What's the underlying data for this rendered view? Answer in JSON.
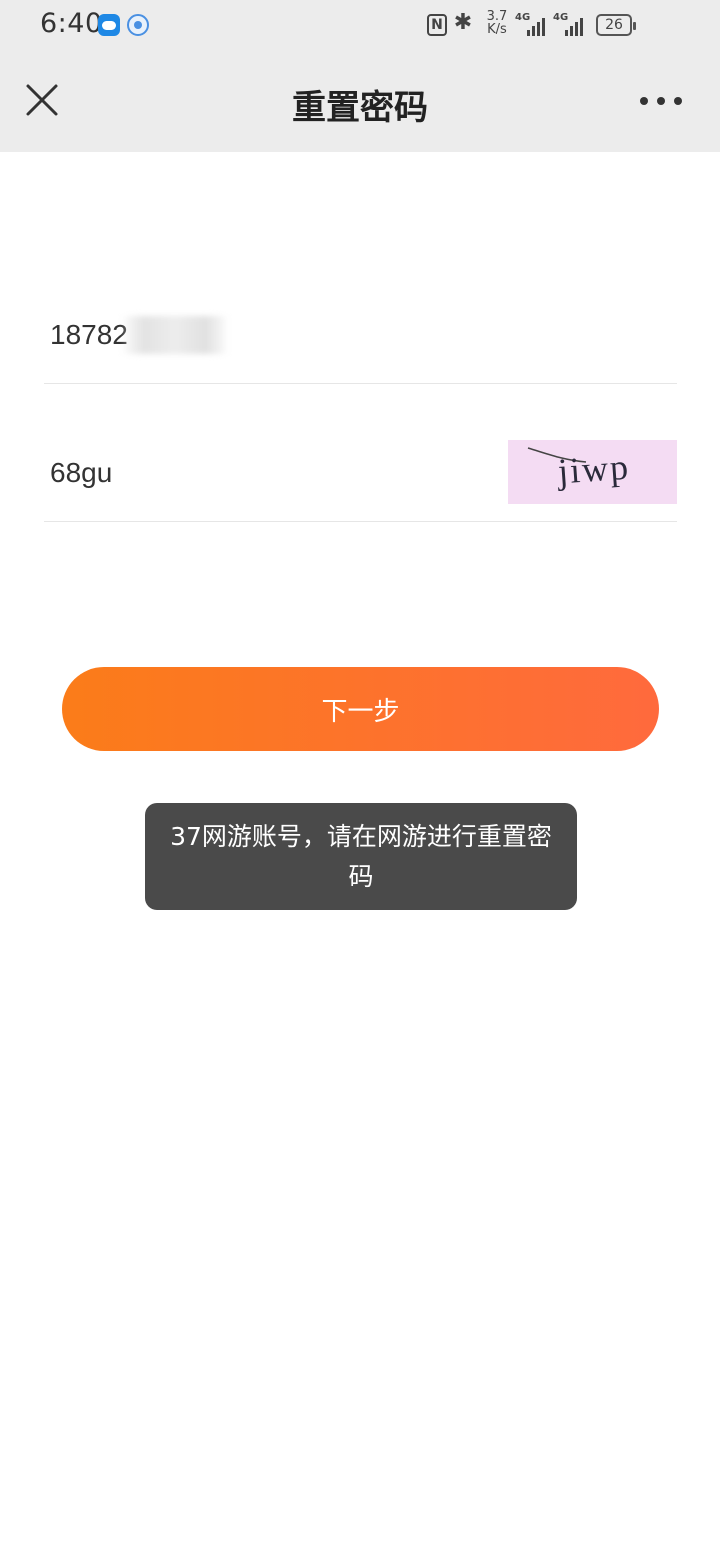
{
  "status_bar": {
    "time": "6:40",
    "nfc_label": "N",
    "bt_symbol": "✱",
    "speed_value": "3.7",
    "speed_unit": "K/s",
    "signal_label": "4G",
    "battery": "26"
  },
  "header": {
    "title": "重置密码"
  },
  "form": {
    "phone_value": "18782",
    "captcha_value": "68gu",
    "captcha_image_text": "jiwp"
  },
  "actions": {
    "next_label": "下一步"
  },
  "toast": {
    "message": "37网游账号，请在网游进行重置密码"
  },
  "colors": {
    "button_start": "#fb7c19",
    "button_end": "#ff6a3d",
    "toast_bg": "#4a4a4a",
    "header_bg": "#ececec"
  }
}
